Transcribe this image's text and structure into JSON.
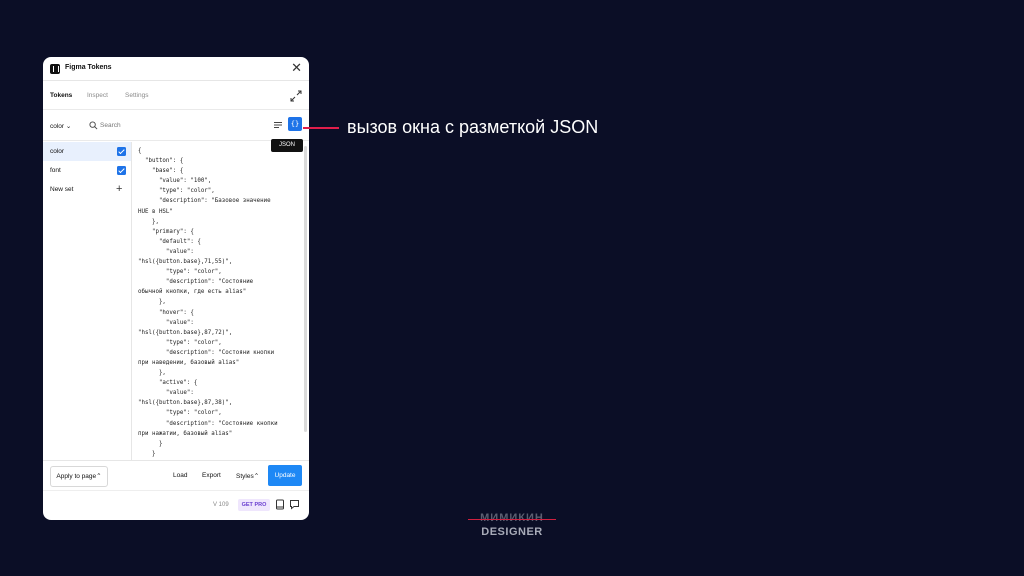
{
  "window": {
    "title": "Figma Tokens"
  },
  "tabs": [
    {
      "label": "Tokens",
      "active": true
    },
    {
      "label": "Inspect",
      "active": false
    },
    {
      "label": "Settings",
      "active": false
    }
  ],
  "toolbar": {
    "set_select": "color ⌄",
    "search_placeholder": "Search",
    "json_button": "{}",
    "json_tooltip": "JSON"
  },
  "sidebar": {
    "sets": [
      {
        "label": "color",
        "checked": true,
        "active": true
      },
      {
        "label": "font",
        "checked": true,
        "active": false
      }
    ],
    "new_set_label": "New set"
  },
  "editor": {
    "json_text": "{\n  \"button\": {\n    \"base\": {\n      \"value\": \"100\",\n      \"type\": \"color\",\n      \"description\": \"Базовое значение\nHUE в HSL\"\n    },\n    \"primary\": {\n      \"default\": {\n        \"value\":\n\"hsl({button.base},71,55)\",\n        \"type\": \"color\",\n        \"description\": \"Состояние\nобычной кнопки, где есть alias\"\n      },\n      \"hover\": {\n        \"value\":\n\"hsl({button.base},87,72)\",\n        \"type\": \"color\",\n        \"description\": \"Состояни кнопки\nпри наведении, базовый alias\"\n      },\n      \"active\": {\n        \"value\":\n\"hsl({button.base},87,38)\",\n        \"type\": \"color\",\n        \"description\": \"Состояние кнопки\nпри нажатии, базовый alias\"\n      }\n    }"
  },
  "footer": {
    "apply_label": "Apply to page⌃",
    "load_label": "Load",
    "export_label": "Export",
    "styles_label": "Styles⌃",
    "update_label": "Update"
  },
  "statusbar": {
    "version": "V 109",
    "pro_label": "GET PRO"
  },
  "annotation": {
    "text": "вызов окна с разметкой JSON"
  },
  "logo": {
    "top": "МИМИКИН",
    "bottom": "DESIGNER"
  },
  "colors": {
    "background": "#0b0e26",
    "accent": "#1e73e8",
    "update": "#1e88f5",
    "pointer": "#e01e4b"
  }
}
